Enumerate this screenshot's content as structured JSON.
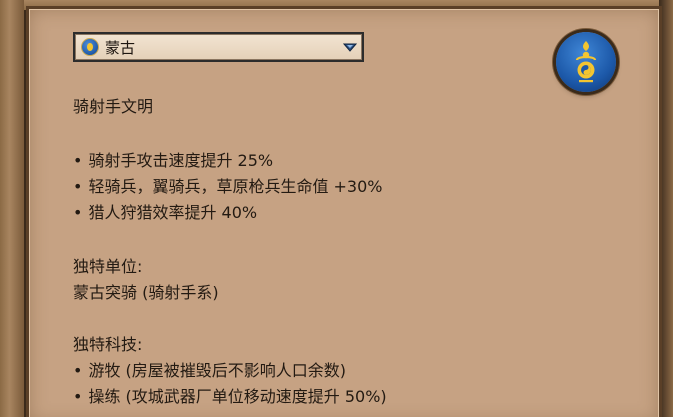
{
  "civ_select": {
    "selected": "蒙古",
    "flag_icon": "mongolia-flag-icon",
    "arrow_icon": "dropdown-arrow-icon"
  },
  "emblem": {
    "icon": "mongolia-emblem-icon",
    "colors": {
      "background": "#1c58a8",
      "symbol": "#f3c530"
    }
  },
  "description": {
    "civ_type": "骑射手文明",
    "bonuses": [
      "骑射手攻击速度提升 25%",
      "轻骑兵，翼骑兵，草原枪兵生命值 +30%",
      "猎人狩猎效率提升 40%"
    ],
    "unique_unit_heading": "独特单位:",
    "unique_unit": "蒙古突骑 (骑射手系)",
    "unique_tech_heading": "独特科技:",
    "unique_techs": [
      "游牧 (房屋被摧毁后不影响人口余数)",
      "操练 (攻城武器厂单位移动速度提升 50%)"
    ]
  },
  "colors": {
    "panel": "#c6a283",
    "panel_border": "#5a3f27",
    "text": "#231a12"
  }
}
